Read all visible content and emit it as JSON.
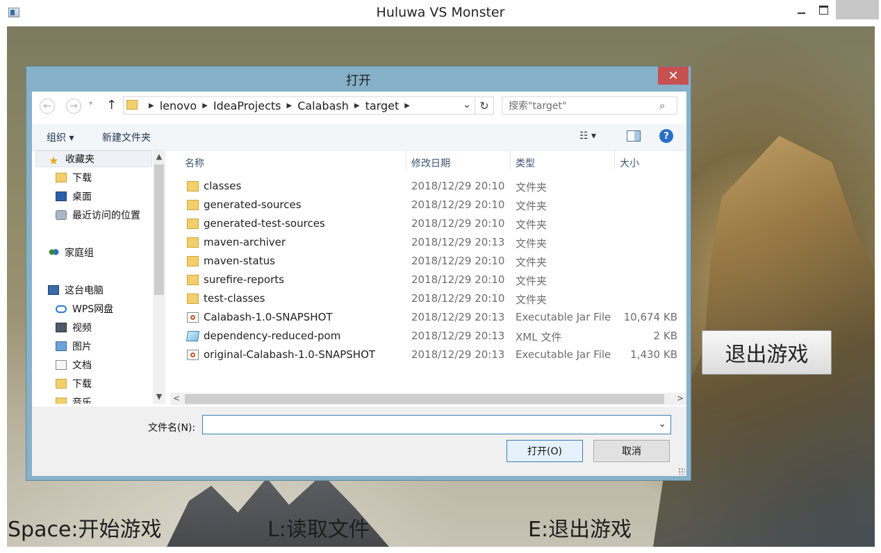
{
  "window": {
    "title": "Huluwa VS Monster",
    "close_glyph": "×"
  },
  "game": {
    "exit_button_label": "退出游戏",
    "hints": {
      "space": "Space:开始游戏",
      "load": "L:读取文件",
      "exit": "E:退出游戏"
    }
  },
  "dialog": {
    "title": "打开",
    "close_glyph": "✕",
    "nav": {
      "back_glyph": "←",
      "forward_glyph": "→",
      "recent_glyph": "▾",
      "up_glyph": "↑",
      "refresh_glyph": "↻"
    },
    "address": {
      "crumbs": [
        "lenovo",
        "IdeaProjects",
        "Calabash",
        "target"
      ],
      "separator": "▶",
      "dropdown_glyph": "⌄"
    },
    "search": {
      "placeholder": "搜索\"target\"",
      "icon": "⌕"
    },
    "toolbar": {
      "organize": "组织 ▾",
      "new_folder": "新建文件夹",
      "view": "☷ ▾",
      "help": "?"
    },
    "nav_pane": {
      "favorites": "收藏夹",
      "items": [
        {
          "label": "下载",
          "icon": "folder-download-icon"
        },
        {
          "label": "桌面",
          "icon": "desktop-icon"
        },
        {
          "label": "最近访问的位置",
          "icon": "recent-places-icon"
        }
      ],
      "homegroup": "家庭组",
      "this_pc": "这台电脑",
      "pc_items": [
        {
          "label": "WPS网盘",
          "icon": "cloud-icon"
        },
        {
          "label": "视频",
          "icon": "videos-icon"
        },
        {
          "label": "图片",
          "icon": "pictures-icon"
        },
        {
          "label": "文档",
          "icon": "documents-icon"
        },
        {
          "label": "下载",
          "icon": "folder-download-icon"
        },
        {
          "label": "音乐",
          "icon": "music-icon"
        }
      ],
      "scroll_up": "▲",
      "scroll_down": "▼"
    },
    "columns": {
      "name": "名称",
      "date": "修改日期",
      "type": "类型",
      "size": "大小",
      "sort_glyph": "^"
    },
    "files": [
      {
        "name": "classes",
        "date": "2018/12/29 20:10",
        "type": "文件夹",
        "size": "",
        "kind": "folder"
      },
      {
        "name": "generated-sources",
        "date": "2018/12/29 20:10",
        "type": "文件夹",
        "size": "",
        "kind": "folder"
      },
      {
        "name": "generated-test-sources",
        "date": "2018/12/29 20:10",
        "type": "文件夹",
        "size": "",
        "kind": "folder"
      },
      {
        "name": "maven-archiver",
        "date": "2018/12/29 20:13",
        "type": "文件夹",
        "size": "",
        "kind": "folder"
      },
      {
        "name": "maven-status",
        "date": "2018/12/29 20:10",
        "type": "文件夹",
        "size": "",
        "kind": "folder"
      },
      {
        "name": "surefire-reports",
        "date": "2018/12/29 20:10",
        "type": "文件夹",
        "size": "",
        "kind": "folder"
      },
      {
        "name": "test-classes",
        "date": "2018/12/29 20:10",
        "type": "文件夹",
        "size": "",
        "kind": "folder"
      },
      {
        "name": "Calabash-1.0-SNAPSHOT",
        "date": "2018/12/29 20:13",
        "type": "Executable Jar File",
        "size": "10,674 KB",
        "kind": "jar"
      },
      {
        "name": "dependency-reduced-pom",
        "date": "2018/12/29 20:13",
        "type": "XML 文件",
        "size": "2 KB",
        "kind": "xml"
      },
      {
        "name": "original-Calabash-1.0-SNAPSHOT",
        "date": "2018/12/29 20:13",
        "type": "Executable Jar File",
        "size": "1,430 KB",
        "kind": "jar"
      }
    ],
    "hscroll": {
      "left": "<",
      "right": ">"
    },
    "filename": {
      "label": "文件名(N):",
      "value": "",
      "dropdown_glyph": "⌄"
    },
    "buttons": {
      "open": "打开(O)",
      "cancel": "取消"
    }
  }
}
